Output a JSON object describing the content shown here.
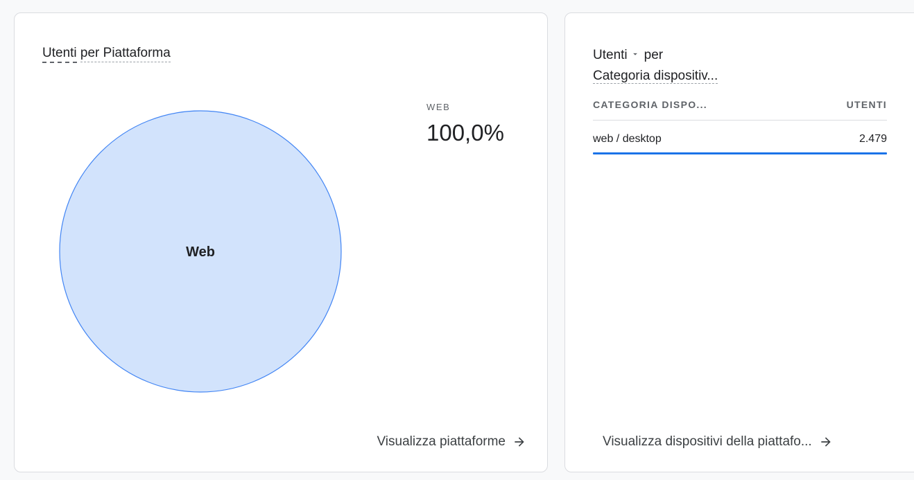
{
  "left_card": {
    "title_part1": "Utenti",
    "title_part2": "per Piattaforma",
    "legend": {
      "category": "WEB",
      "value": "100,0%"
    },
    "footer_link": "Visualizza piattaforme"
  },
  "right_card": {
    "metric": "Utenti",
    "by": "per",
    "dimension": "Categoria dispositiv...",
    "table": {
      "headers": [
        "CATEGORIA DISPO...",
        "UTENTI"
      ],
      "rows": [
        {
          "category": "web / desktop",
          "value": "2.479",
          "share": 1.0
        }
      ]
    },
    "footer_link": "Visualizza dispositivi della piattafo..."
  },
  "chart_data": {
    "type": "pie",
    "categories": [
      "Web"
    ],
    "values": [
      100.0
    ],
    "colors": {
      "fill": "#d2e3fc",
      "stroke": "#4285f4"
    }
  },
  "colors": {
    "accent": "#1a73e8"
  },
  "icons": {
    "footer_arrow": "arrow-right-icon",
    "metric_dropdown": "caret-down-icon"
  }
}
